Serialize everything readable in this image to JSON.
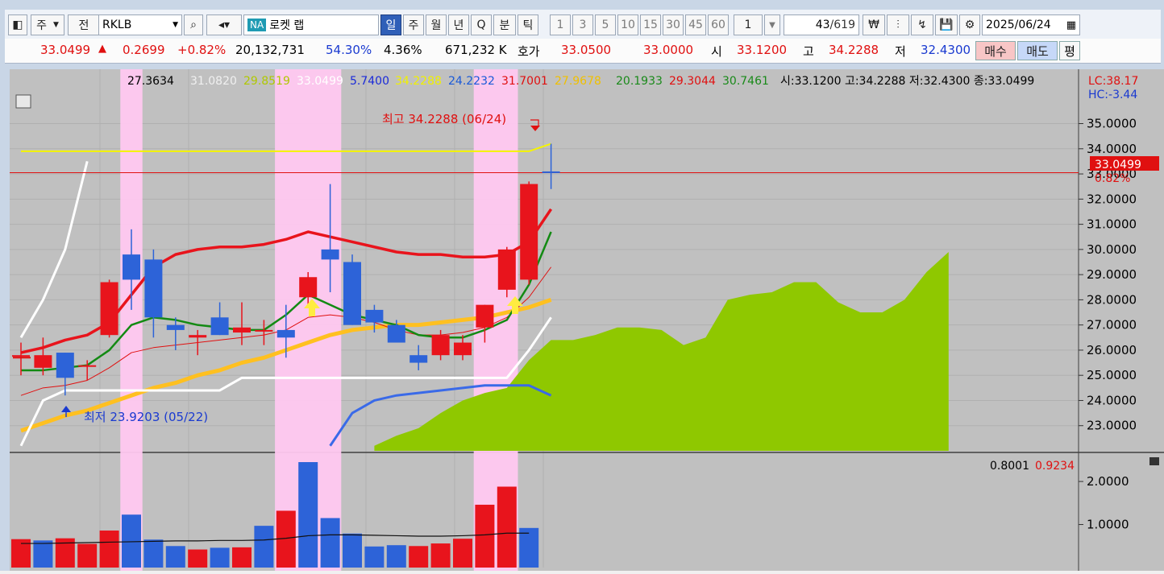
{
  "toolbar": {
    "market": "주",
    "period_unit": "전",
    "symbol": "RKLB",
    "na_badge": "NA",
    "name": "로켓 랩",
    "tabs": [
      "일",
      "주",
      "월",
      "년",
      "Q",
      "분",
      "틱"
    ],
    "active_tab": "일",
    "intervals": [
      "1",
      "3",
      "5",
      "10",
      "15",
      "30",
      "45",
      "60"
    ],
    "count_value": "1",
    "position": "43",
    "total": "/619",
    "date": "2025/06/24"
  },
  "quote": {
    "price": "33.0499",
    "change": "0.2699",
    "change_pct": "+0.82%",
    "volume": "20,132,731",
    "vol_ratio": "54.30%",
    "turnover": "4.36%",
    "amount": "671,232 K",
    "bid_label": "호가",
    "bid1": "33.0500",
    "bid2": "33.0000",
    "open_label": "시",
    "open": "33.1200",
    "high_label": "고",
    "high": "34.2288",
    "low_label": "저",
    "low": "32.4300",
    "buy_label": "매수",
    "sell_label": "매도",
    "flat_label": "평"
  },
  "legend": {
    "l1": "27.3634",
    "l2": "31.0820",
    "l3": "29.8519",
    "l4": "33.0499",
    "l5": "5.7400",
    "l6": "34.2288",
    "l7": "24.2232",
    "l8": "31.7001",
    "l9": "27.9678",
    "l10": "20.1933",
    "l11": "29.3044",
    "l12": "30.7461",
    "ohlc": "시:33.1200 고:34.2288 저:32.4300 종:33.0499",
    "lc": "LC:38.17",
    "hc": "HC:-3.44"
  },
  "annotations": {
    "high": "최고 34.2288 (06/24)",
    "low": "최저 23.9203 (05/22)",
    "last_price": "33.0499",
    "last_pct": "0.82%"
  },
  "volume_legend": {
    "v1": "0.8001",
    "v2": "0.9234"
  },
  "colors": {
    "up": "#e8141c",
    "down": "#2d63d8",
    "cloud": "#8fc800",
    "highlight": "#ffc8f0",
    "chart_bg": "#c0c0c0"
  },
  "chart_data": {
    "type": "candlestick",
    "price_axis": [
      "35.0000",
      "34.0000",
      "33.0000",
      "32.0000",
      "31.0000",
      "30.0000",
      "29.0000",
      "28.0000",
      "27.0000",
      "26.0000",
      "25.0000",
      "24.0000",
      "23.0000"
    ],
    "volume_axis": [
      "2.0000",
      "1.0000"
    ],
    "price_range": [
      22.0,
      36.2
    ],
    "volume_range": [
      0,
      2.6
    ],
    "candles": [
      {
        "o": 25.8,
        "h": 26.3,
        "l": 25.0,
        "c": 25.8
      },
      {
        "o": 25.3,
        "h": 26.5,
        "l": 25.0,
        "c": 25.8
      },
      {
        "o": 25.9,
        "h": 25.9,
        "l": 24.2,
        "c": 24.9
      },
      {
        "o": 25.4,
        "h": 25.6,
        "l": 24.8,
        "c": 25.4
      },
      {
        "o": 26.6,
        "h": 28.8,
        "l": 26.5,
        "c": 28.7
      },
      {
        "o": 29.8,
        "h": 30.8,
        "l": 27.6,
        "c": 28.8
      },
      {
        "o": 29.6,
        "h": 30.0,
        "l": 26.5,
        "c": 27.3
      },
      {
        "o": 27.0,
        "h": 27.3,
        "l": 26.0,
        "c": 26.8
      },
      {
        "o": 26.5,
        "h": 26.8,
        "l": 25.8,
        "c": 26.6
      },
      {
        "o": 27.3,
        "h": 27.9,
        "l": 26.6,
        "c": 26.6
      },
      {
        "o": 26.7,
        "h": 27.9,
        "l": 26.2,
        "c": 26.9
      },
      {
        "o": 26.8,
        "h": 27.2,
        "l": 26.2,
        "c": 26.8
      },
      {
        "o": 26.8,
        "h": 27.8,
        "l": 25.7,
        "c": 26.5
      },
      {
        "o": 28.1,
        "h": 29.1,
        "l": 27.8,
        "c": 28.9
      },
      {
        "o": 30.0,
        "h": 32.6,
        "l": 28.3,
        "c": 29.6
      },
      {
        "o": 29.5,
        "h": 29.8,
        "l": 27.0,
        "c": 27.0
      },
      {
        "o": 27.6,
        "h": 27.8,
        "l": 26.7,
        "c": 27.1
      },
      {
        "o": 27.0,
        "h": 27.2,
        "l": 26.4,
        "c": 26.3
      },
      {
        "o": 25.8,
        "h": 26.2,
        "l": 25.2,
        "c": 25.5
      },
      {
        "o": 25.8,
        "h": 26.8,
        "l": 25.6,
        "c": 26.6
      },
      {
        "o": 25.8,
        "h": 26.6,
        "l": 25.6,
        "c": 26.3
      },
      {
        "o": 26.9,
        "h": 27.8,
        "l": 26.3,
        "c": 27.8
      },
      {
        "o": 28.4,
        "h": 30.1,
        "l": 28.1,
        "c": 30.0
      },
      {
        "o": 28.8,
        "h": 32.7,
        "l": 28.6,
        "c": 32.6
      },
      {
        "o": 33.1,
        "h": 34.2,
        "l": 32.4,
        "c": 33.05
      }
    ],
    "volumes": [
      0.66,
      0.63,
      0.68,
      0.55,
      0.86,
      1.23,
      0.65,
      0.5,
      0.42,
      0.46,
      0.47,
      0.97,
      1.32,
      2.45,
      1.15,
      0.79,
      0.49,
      0.52,
      0.5,
      0.56,
      0.67,
      1.46,
      1.88,
      0.92
    ],
    "volume_up": [
      true,
      false,
      true,
      true,
      true,
      false,
      false,
      false,
      true,
      false,
      true,
      false,
      true,
      false,
      false,
      false,
      false,
      false,
      true,
      true,
      true,
      true,
      true,
      false
    ],
    "highlight_ranges": [
      [
        5,
        5
      ],
      [
        12,
        14
      ],
      [
        21,
        22
      ]
    ],
    "ma_red": [
      25.9,
      26.1,
      26.4,
      26.6,
      27.1,
      28.2,
      29.3,
      29.8,
      30.0,
      30.1,
      30.1,
      30.2,
      30.4,
      30.7,
      30.5,
      30.3,
      30.1,
      29.9,
      29.8,
      29.8,
      29.7,
      29.7,
      29.8,
      30.3,
      31.6
    ],
    "ma_green": [
      25.2,
      25.2,
      25.3,
      25.4,
      26.0,
      27.0,
      27.3,
      27.2,
      27.0,
      26.9,
      26.8,
      26.8,
      27.4,
      28.2,
      27.8,
      27.4,
      27.2,
      27.0,
      26.6,
      26.5,
      26.5,
      26.8,
      27.2,
      28.6,
      30.7
    ],
    "ma_thin": [
      24.2,
      24.5,
      24.6,
      24.8,
      25.3,
      25.9,
      26.1,
      26.2,
      26.3,
      26.4,
      26.5,
      26.6,
      26.8,
      27.3,
      27.4,
      27.3,
      27.1,
      26.8,
      26.6,
      26.6,
      26.7,
      26.9,
      27.3,
      28.1,
      29.3
    ],
    "ma_yellow": [
      22.8,
      23.1,
      23.4,
      23.6,
      23.9,
      24.2,
      24.5,
      24.7,
      25.0,
      25.2,
      25.5,
      25.7,
      26.0,
      26.3,
      26.6,
      26.8,
      26.9,
      27.0,
      27.0,
      27.1,
      27.2,
      27.3,
      27.5,
      27.7,
      28.0
    ],
    "upper_band": [
      33.9,
      33.9,
      33.9,
      33.9,
      33.9,
      33.9,
      33.9,
      33.9,
      33.9,
      33.9,
      33.9,
      33.9,
      33.9,
      33.9,
      33.9,
      33.9,
      33.9,
      33.9,
      33.9,
      33.9,
      33.9,
      33.9,
      33.9,
      33.9,
      34.2
    ],
    "white_upper": [
      26.5,
      28.0,
      30.0,
      33.5,
      null
    ],
    "white_lower": [
      22.2,
      24.0,
      24.4,
      24.4,
      24.4,
      24.4,
      24.4,
      24.4,
      24.4,
      24.4,
      24.9,
      24.9,
      24.9,
      24.9,
      24.9,
      24.9,
      24.9,
      24.9,
      24.9,
      24.9,
      24.9,
      24.9,
      24.9,
      26.0,
      27.3
    ],
    "blue_line": [
      22.2,
      23.5,
      24.0,
      24.2,
      24.3,
      24.4,
      24.5,
      24.6,
      24.6,
      24.6,
      24.2
    ],
    "cloud": [
      22.2,
      22.6,
      22.9,
      23.5,
      24.0,
      24.3,
      24.5,
      25.6,
      26.4,
      26.4,
      26.6,
      26.9,
      26.9,
      26.8,
      26.2,
      26.5,
      28.0,
      28.2,
      28.3,
      28.7,
      28.7,
      27.9,
      27.5,
      27.5,
      28.0,
      29.1,
      29.9
    ],
    "bid_line": 33.05
  }
}
